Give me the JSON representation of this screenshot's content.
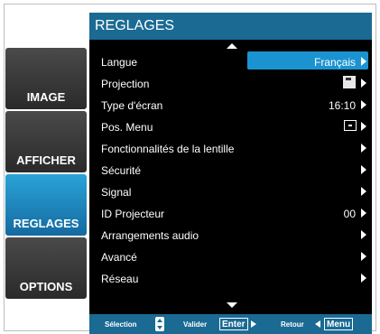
{
  "header": {
    "title": "REGLAGES"
  },
  "sidebar": {
    "items": [
      {
        "label": "IMAGE"
      },
      {
        "label": "AFFICHER"
      },
      {
        "label": "REGLAGES",
        "active": true
      },
      {
        "label": "OPTIONS"
      }
    ]
  },
  "menu": {
    "rows": [
      {
        "label": "Langue",
        "value": "Français"
      },
      {
        "label": "Projection",
        "icon": "projection-icon"
      },
      {
        "label": "Type d'écran",
        "value": "16:10"
      },
      {
        "label": "Pos. Menu",
        "icon": "menu-position-icon"
      },
      {
        "label": "Fonctionnalités de la lentille"
      },
      {
        "label": "Sécurité"
      },
      {
        "label": "Signal"
      },
      {
        "label": "ID Projecteur",
        "value": "00"
      },
      {
        "label": "Arrangements audio"
      },
      {
        "label": "Avancé"
      },
      {
        "label": "Réseau"
      }
    ]
  },
  "footer": {
    "selection": "Sélection",
    "validate": "Valider",
    "enter": "Enter",
    "back": "Retour",
    "menu": "Menu"
  },
  "colors": {
    "accent": "#1b93d1",
    "header": "#1a6a93",
    "background": "#000000"
  }
}
